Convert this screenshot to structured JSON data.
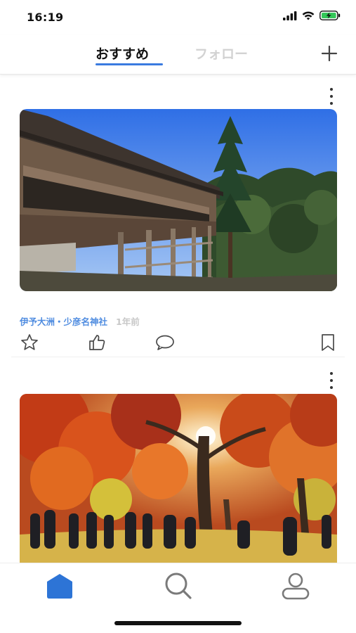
{
  "status_bar": {
    "time": "16:19",
    "icons": [
      "signal-icon",
      "wifi-icon",
      "battery-charging-icon"
    ],
    "battery_color": "#34c759"
  },
  "header": {
    "tabs": [
      {
        "label": "おすすめ",
        "active": true
      },
      {
        "label": "フォロー",
        "active": false
      }
    ],
    "accent_color": "#3a7be0",
    "add_icon": "plus-icon"
  },
  "feed": {
    "posts": [
      {
        "image": "temple-veranda-with-cedar-tree-photo",
        "location": "伊予大洲・少彦名神社",
        "time_ago": "1年前",
        "actions": [
          "star-icon",
          "thumbs-up-icon",
          "comment-icon",
          "bookmark-icon"
        ]
      },
      {
        "image": "autumn-maple-trees-with-crowd-photo"
      }
    ]
  },
  "bottom_nav": {
    "items": [
      {
        "icon": "home-icon",
        "active": true
      },
      {
        "icon": "search-icon",
        "active": false
      },
      {
        "icon": "profile-icon",
        "active": false
      }
    ]
  }
}
